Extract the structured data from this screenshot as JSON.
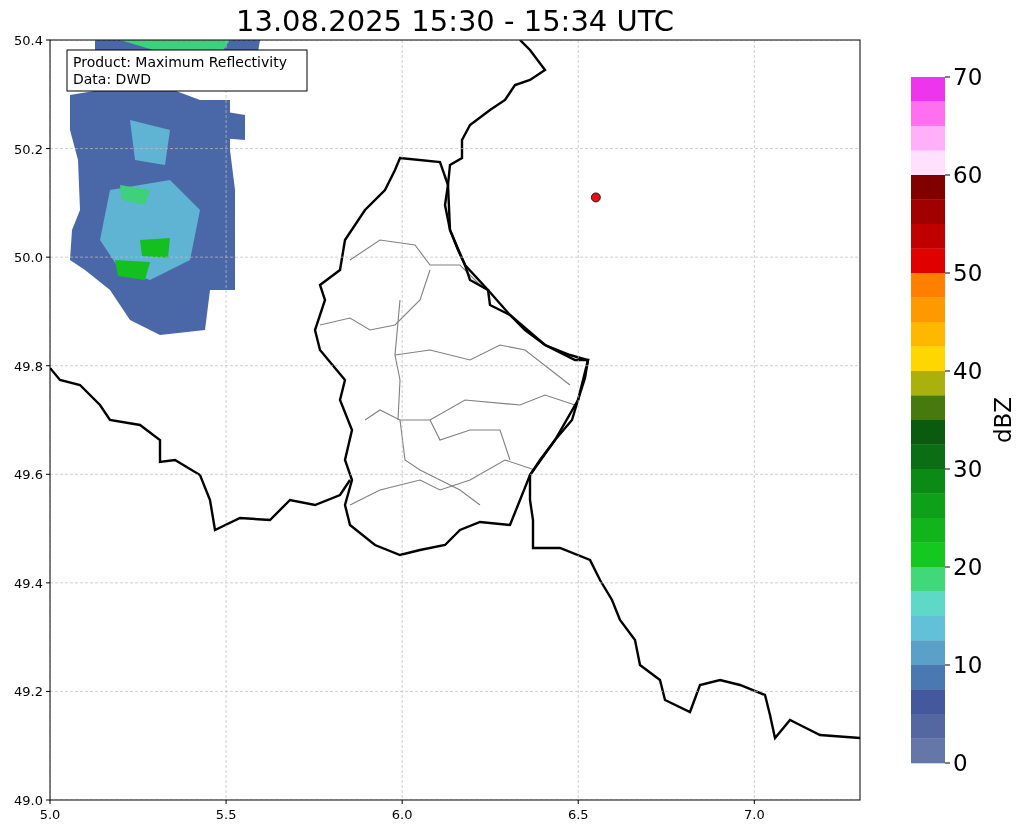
{
  "title": "13.08.2025 15:30 - 15:34 UTC",
  "info_box": {
    "lines": [
      "Product: Maximum Reflectivity",
      "Data: DWD"
    ]
  },
  "map": {
    "chart_data": {
      "type": "scatter",
      "xlim": [
        5.0,
        7.3
      ],
      "ylim": [
        49.0,
        50.4
      ],
      "xticks": [
        {
          "value": 5.0,
          "label": "5.0"
        },
        {
          "value": 5.5,
          "label": "5.5"
        },
        {
          "value": 6.0,
          "label": "6.0"
        },
        {
          "value": 6.5,
          "label": "6.5"
        },
        {
          "value": 7.0,
          "label": "7.0"
        }
      ],
      "yticks": [
        {
          "value": 49.0,
          "label": "49.0"
        },
        {
          "value": 49.2,
          "label": "49.2"
        },
        {
          "value": 49.4,
          "label": "49.4"
        },
        {
          "value": 49.6,
          "label": "49.6"
        },
        {
          "value": 49.8,
          "label": "49.8"
        },
        {
          "value": 50.0,
          "label": "50.0"
        },
        {
          "value": 50.2,
          "label": "50.2"
        },
        {
          "value": 50.4,
          "label": "50.4"
        }
      ],
      "grid": true,
      "x": [
        6.55
      ],
      "series": [
        {
          "color": "#e81010",
          "values": [
            50.11
          ]
        }
      ]
    }
  },
  "colorbar": {
    "label": "dBZ",
    "ticks": [
      "70",
      "60",
      "50",
      "40",
      "30",
      "20",
      "10",
      "0"
    ],
    "segments": [
      {
        "color": "#ee35ee"
      },
      {
        "color": "#ff70f0"
      },
      {
        "color": "#ffb0f8"
      },
      {
        "color": "#ffe0ff"
      },
      {
        "color": "#800000"
      },
      {
        "color": "#a00000"
      },
      {
        "color": "#c00000"
      },
      {
        "color": "#e00000"
      },
      {
        "color": "#ff8000"
      },
      {
        "color": "#ff9900"
      },
      {
        "color": "#ffb800"
      },
      {
        "color": "#ffd700"
      },
      {
        "color": "#aab00c"
      },
      {
        "color": "#467a0e"
      },
      {
        "color": "#0a5a10"
      },
      {
        "color": "#0b6e14"
      },
      {
        "color": "#0b8a16"
      },
      {
        "color": "#0fa01a"
      },
      {
        "color": "#12b41c"
      },
      {
        "color": "#14c820"
      },
      {
        "color": "#40d878"
      },
      {
        "color": "#60d8c8"
      },
      {
        "color": "#62c0d8"
      },
      {
        "color": "#5aa0c8"
      },
      {
        "color": "#4a78b0"
      },
      {
        "color": "#44589e"
      },
      {
        "color": "#5567a0"
      },
      {
        "color": "#6477a8"
      }
    ]
  }
}
